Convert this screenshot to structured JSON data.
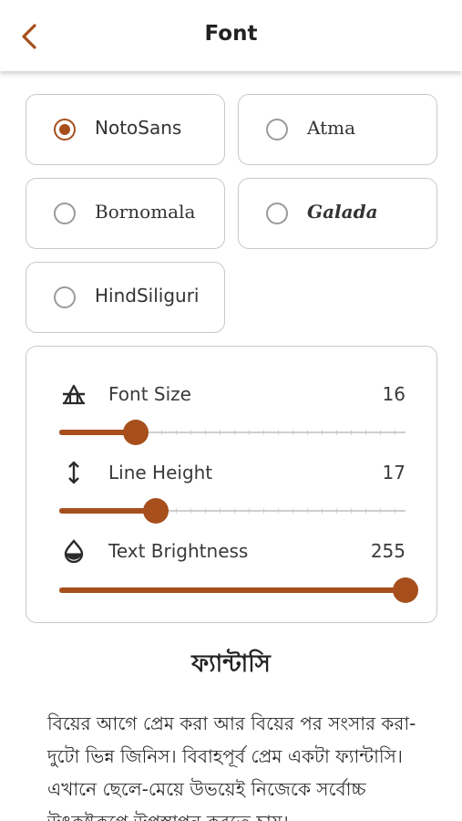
{
  "header": {
    "title": "Font",
    "back_icon": "chevron-left-icon",
    "accent_color": "#a64f1d"
  },
  "fonts": {
    "options": [
      {
        "label": "NotoSans",
        "selected": true
      },
      {
        "label": "Atma",
        "selected": false
      },
      {
        "label": "Bornomala",
        "selected": false
      },
      {
        "label": "Galada",
        "selected": false
      },
      {
        "label": "HindSiliguri",
        "selected": false
      }
    ]
  },
  "settings": {
    "font_size": {
      "label": "Font Size",
      "value": "16",
      "icon": "font-size-icon",
      "fraction": 0.22
    },
    "line_height": {
      "label": "Line Height",
      "value": "17",
      "icon": "line-height-icon",
      "fraction": 0.28
    },
    "text_brightness": {
      "label": "Text Brightness",
      "value": "255",
      "icon": "brightness-drop-icon",
      "fraction": 1.0
    }
  },
  "preview": {
    "title": "ফ্যান্টাসি",
    "body": "বিয়ের আগে প্রেম করা আর বিয়ের পর সংসার করা-দুটো ভিন্ন জিনিস। বিবাহপূর্ব প্রেম একটা ফ্যান্টাসি। এখানে ছেলে-মেয়ে উভয়েই নিজেকে সর্বোচ্চ উৎকৃষ্টরূপে উপস্থাপন করতে চায়।"
  }
}
